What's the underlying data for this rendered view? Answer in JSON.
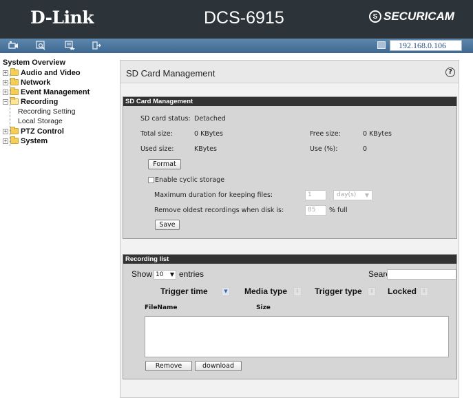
{
  "header": {
    "brand": "D-Link",
    "model": "DCS-6915",
    "partner_brand": "SECURICAM"
  },
  "toolbar": {
    "icons": [
      "live-video-icon",
      "setup-icon",
      "maintenance-icon",
      "logout-icon"
    ],
    "ip_address": "192.168.0.106"
  },
  "sidebar": {
    "overview": "System Overview",
    "items": [
      {
        "label": "Audio and Video",
        "expanded": false
      },
      {
        "label": "Network",
        "expanded": false
      },
      {
        "label": "Event Management",
        "expanded": false
      },
      {
        "label": "Recording",
        "expanded": true
      },
      {
        "label": "PTZ Control",
        "expanded": false
      },
      {
        "label": "System",
        "expanded": false
      }
    ],
    "recording_children": [
      "Recording Setting",
      "Local Storage"
    ]
  },
  "main": {
    "title": "SD Card Management",
    "help_symbol": "?"
  },
  "sd_card": {
    "section_title": "SD Card Management",
    "status_label": "SD card status:",
    "status_value": "Detached",
    "total_label": "Total size:",
    "total_value": "0 KBytes",
    "free_label": "Free size:",
    "free_value": "0 KBytes",
    "used_label": "Used size:",
    "used_value": "KBytes",
    "use_pct_label": "Use (%):",
    "use_pct_value": "0",
    "format_label": "Format",
    "cyclic_label": "Enable cyclic storage",
    "cyclic_checked": false,
    "max_duration_label": "Maximum duration for keeping files:",
    "max_duration_value": "1",
    "max_duration_unit": "day(s)",
    "remove_oldest_label": "Remove oldest recordings when disk is:",
    "remove_oldest_value": "85",
    "remove_oldest_suffix": "% full",
    "save_label": "Save"
  },
  "recording_list": {
    "section_title": "Recording list",
    "show_label": "Show",
    "entries_value": "10",
    "entries_label": "entries",
    "search_label": "Search:",
    "search_value": "",
    "columns": [
      "Trigger time",
      "Media type",
      "Trigger type",
      "Locked"
    ],
    "file_headers": [
      "FileName",
      "Size"
    ],
    "remove_label": "Remove",
    "download_label": "download"
  },
  "colors": {
    "header_bg": "#2d3439",
    "toolbar_bg": "#4d76a0",
    "section_head_bg": "#333333",
    "panel_bg": "#d6d6d6"
  }
}
